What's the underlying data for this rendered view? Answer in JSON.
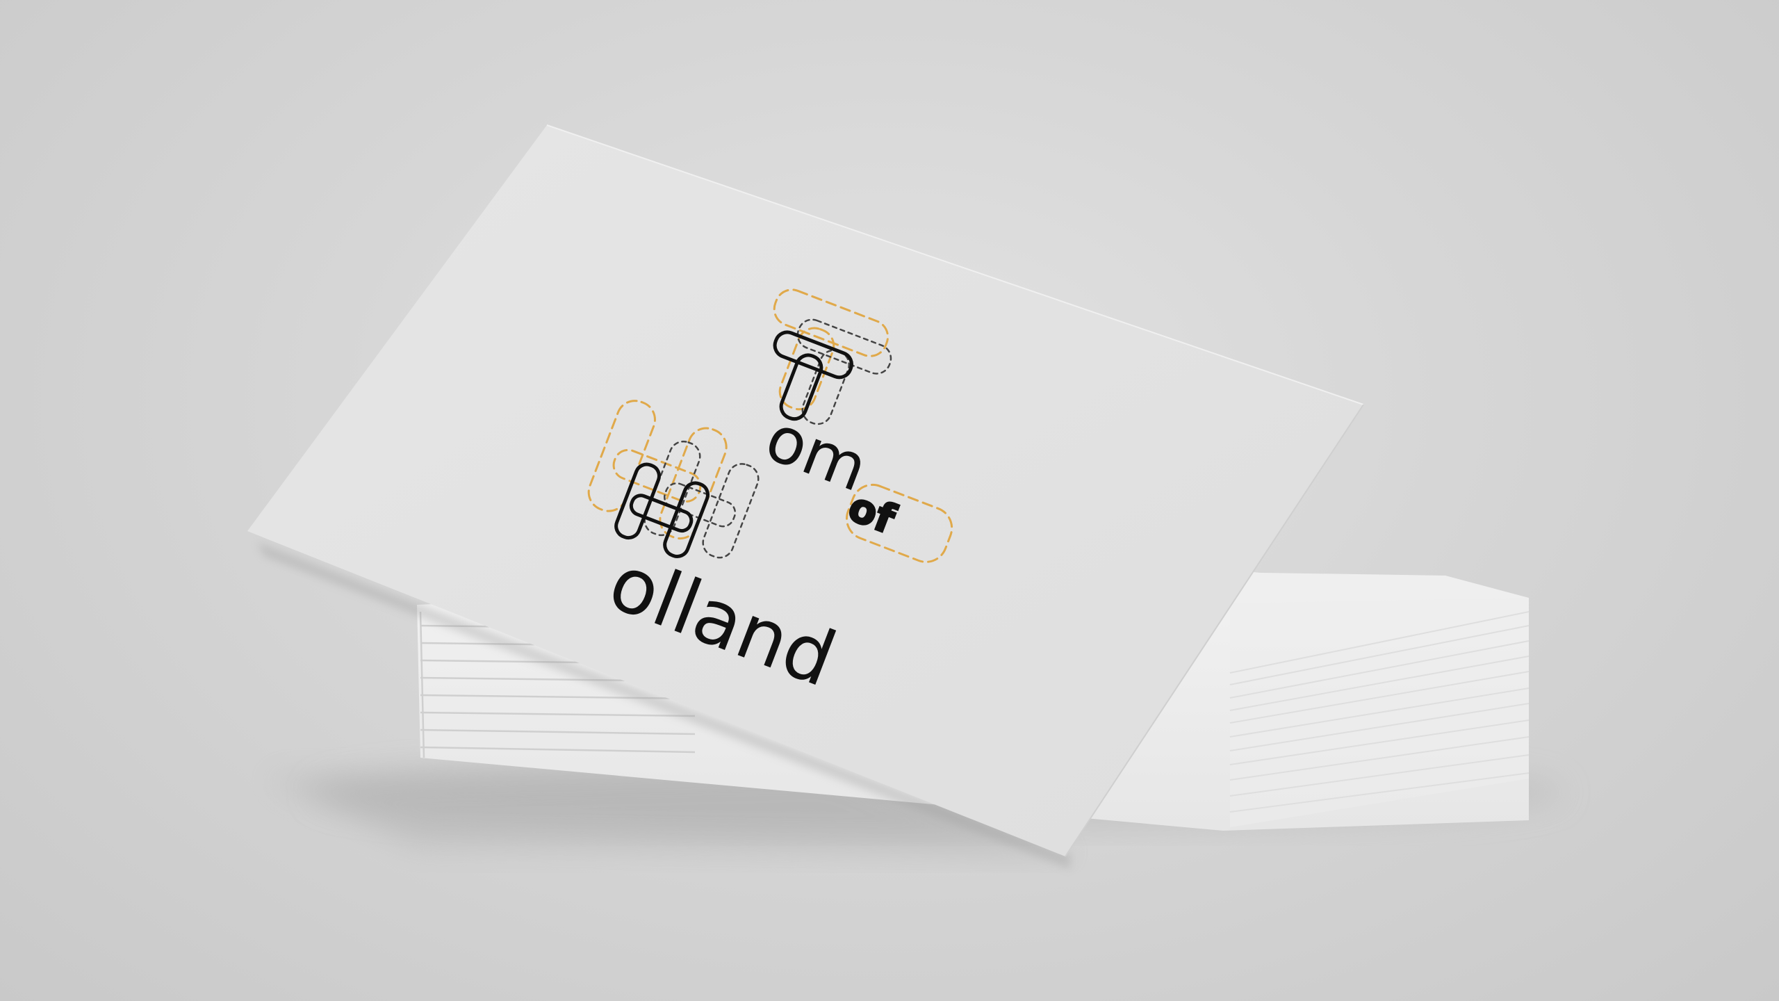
{
  "scene": {
    "description_free": true,
    "background_color": "#d9d9d9",
    "card_color": "#e3e3e3",
    "stack_color": "#ececec",
    "ink_color": "#111111",
    "accent_color": "#e0a94a",
    "dash_color": "#444444"
  },
  "logo": {
    "letter_t": "T",
    "word_om": "om",
    "word_of": "of",
    "letter_h": "H",
    "word_olland": "olland"
  }
}
